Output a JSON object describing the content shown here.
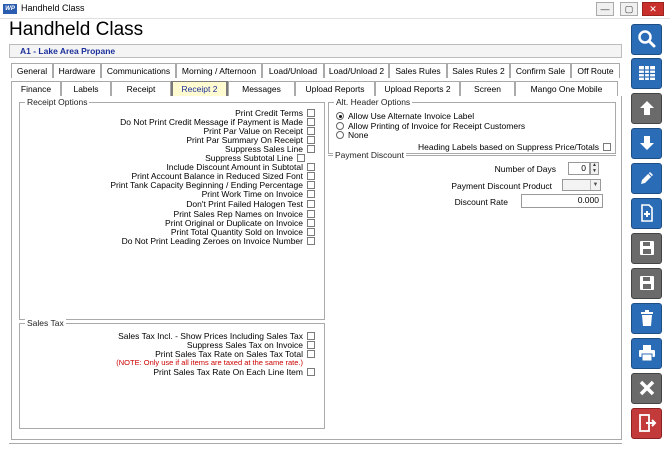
{
  "window": {
    "title": "Handheld Class",
    "app_icon_text": "WP",
    "min": "—",
    "max": "▢",
    "close": "✕"
  },
  "header": {
    "heading": "Handheld Class",
    "company": "A1 - Lake Area Propane"
  },
  "tabs_row1": [
    "General",
    "Hardware",
    "Communications",
    "Morning / Afternoon",
    "Load/Unload",
    "Load/Unload 2",
    "Sales Rules",
    "Sales Rules 2",
    "Confirm Sale",
    "Off Route"
  ],
  "tabs_row2": [
    "Finance",
    "Labels",
    "Receipt",
    "Receipt 2",
    "Messages",
    "Upload Reports",
    "Upload Reports 2",
    "Screen",
    "Mango One Mobile"
  ],
  "active_tab": "Receipt 2",
  "receipt_options": {
    "legend": "Receipt Options",
    "items": [
      {
        "label": "Print Credit Terms",
        "checked": false
      },
      {
        "label": "Do Not Print Credit Message if Payment is Made",
        "checked": false
      },
      {
        "label": "Print Par Value on Receipt",
        "checked": false
      },
      {
        "label": "Print Par Summary On Receipt",
        "checked": false
      },
      {
        "label": "Suppress Sales Line",
        "checked": false
      },
      {
        "label": "Suppress Subtotal Line",
        "checked": false
      },
      {
        "label": "Include Discount Amount in Subtotal",
        "checked": false
      },
      {
        "label": "Print Account Balance in Reduced Sized Font",
        "checked": false
      },
      {
        "label": "Print Tank Capacity Beginning / Ending Percentage",
        "checked": false
      },
      {
        "label": "Print Work Time on  Invoice",
        "checked": false
      },
      {
        "label": "Don't Print Failed Halogen Test",
        "checked": false
      },
      {
        "label": "Print Sales Rep Names on Invoice",
        "checked": false
      },
      {
        "label": "Print Original or Duplicate on Invoice",
        "checked": false
      },
      {
        "label": "Print Total Quantity Sold on Invoice",
        "checked": false
      },
      {
        "label": "Do Not Print Leading Zeroes on Invoice Number",
        "checked": false
      }
    ]
  },
  "sales_tax": {
    "legend": "Sales Tax",
    "items": [
      {
        "label": "Sales Tax Incl. - Show Prices Including Sales Tax",
        "checked": false
      },
      {
        "label": "Suppress Sales Tax on Invoice",
        "checked": false
      },
      {
        "label": "Print Sales Tax Rate on Sales Tax Total",
        "checked": false
      },
      {
        "label": "Print Sales Tax Rate On Each Line Item",
        "checked": false
      }
    ],
    "note": "(NOTE: Only use if all items are taxed at the same rate.)"
  },
  "alt_header": {
    "legend": "Alt. Header Options",
    "options": [
      "Allow Use Alternate Invoice Label",
      "Allow Printing of Invoice for Receipt Customers",
      "None"
    ],
    "selected": 0,
    "heading_labels": "Heading Labels based on Suppress Price/Totals"
  },
  "payment_discount": {
    "legend": "Payment Discount",
    "days_label": "Number of Days",
    "days_value": "0",
    "product_label": "Payment Discount Product",
    "product_value": "",
    "rate_label": "Discount Rate",
    "rate_value": "0.000"
  },
  "colors": {
    "accent_blue": "#2b6cb6",
    "grey_button": "#6a6a6a",
    "exit_red": "#c23a3a",
    "company_text": "#1a2f9a",
    "active_tab_bg": "#fffbd0",
    "note_red": "#cc0000"
  },
  "sidebar": [
    {
      "name": "search-icon",
      "style": "blue"
    },
    {
      "name": "grid-icon",
      "style": "blue"
    },
    {
      "name": "arrow-up-icon",
      "style": "grey"
    },
    {
      "name": "arrow-down-icon",
      "style": "blue"
    },
    {
      "name": "pencil-icon",
      "style": "blue"
    },
    {
      "name": "new-document-icon",
      "style": "blue"
    },
    {
      "name": "save-new-icon",
      "style": "grey"
    },
    {
      "name": "save-icon",
      "style": "grey"
    },
    {
      "name": "trash-icon",
      "style": "blue"
    },
    {
      "name": "printer-icon",
      "style": "blue"
    },
    {
      "name": "cancel-icon",
      "style": "grey"
    },
    {
      "name": "exit-icon",
      "style": "red"
    }
  ]
}
